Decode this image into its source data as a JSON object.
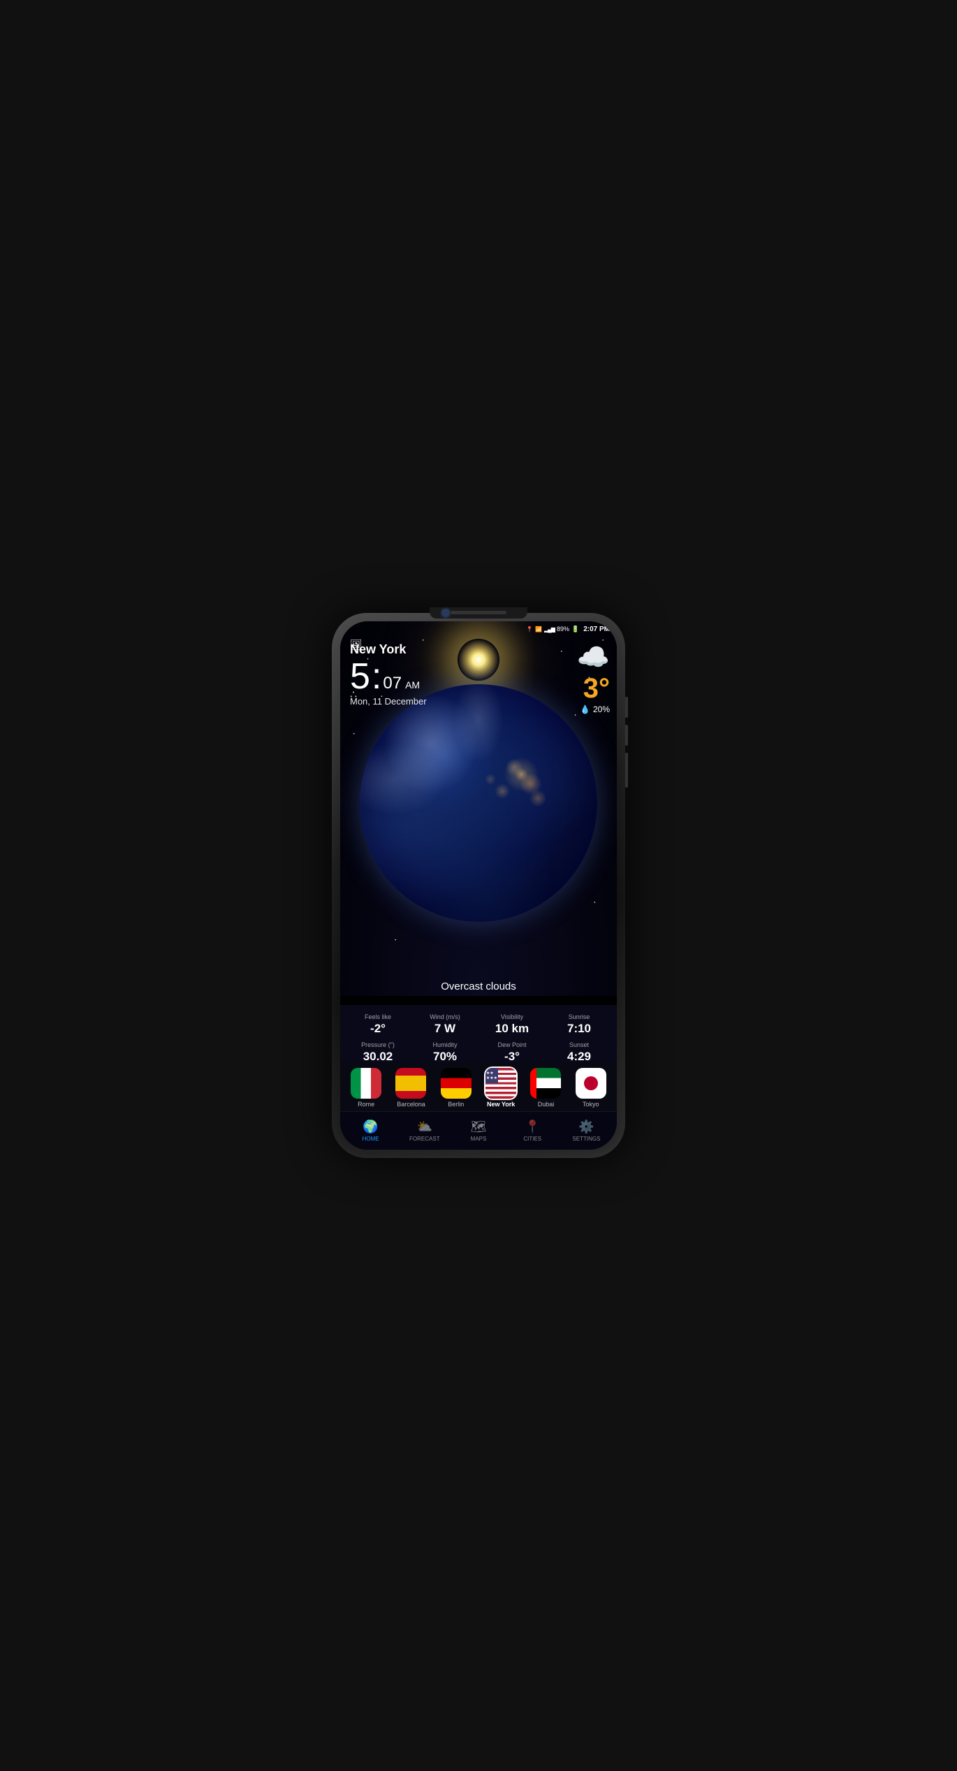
{
  "phone": {
    "status_bar": {
      "location_icon": "📍",
      "wifi_icon": "wifi",
      "signal_icon": "signal",
      "battery": "89%",
      "time": "2:07 PM"
    },
    "weather": {
      "city": "New York",
      "time_hour": "5",
      "time_min": "07",
      "time_ampm": "AM",
      "date": "Mon, 11 December",
      "temperature": "3°",
      "rain_percent": "20%",
      "condition": "Overcast clouds",
      "details": [
        {
          "label": "Feels like",
          "value": "-2°",
          "sub": ""
        },
        {
          "label": "Wind (m/s)",
          "value": "7 W",
          "sub": ""
        },
        {
          "label": "Visibility",
          "value": "10 km",
          "sub": ""
        },
        {
          "label": "Sunrise",
          "value": "7:10",
          "sub": ""
        },
        {
          "label": "Pressure (\")",
          "value": "30.02",
          "sub": ""
        },
        {
          "label": "Humidity",
          "value": "70%",
          "sub": ""
        },
        {
          "label": "Dew Point",
          "value": "-3°",
          "sub": ""
        },
        {
          "label": "Sunset",
          "value": "4:29",
          "sub": ""
        }
      ]
    },
    "cities": [
      {
        "id": "rome",
        "label": "Rome",
        "flag_type": "rome",
        "active": false
      },
      {
        "id": "barcelona",
        "label": "Barcelona",
        "flag_type": "barcelona",
        "active": false
      },
      {
        "id": "berlin",
        "label": "Berlin",
        "flag_type": "berlin",
        "active": false
      },
      {
        "id": "newyork",
        "label": "New York",
        "flag_type": "newyork",
        "active": true
      },
      {
        "id": "dubai",
        "label": "Dubai",
        "flag_type": "dubai",
        "active": false
      },
      {
        "id": "tokyo",
        "label": "Tokyo",
        "flag_type": "tokyo",
        "active": false
      }
    ],
    "nav": [
      {
        "id": "home",
        "label": "HOME",
        "icon": "🌍",
        "active": true
      },
      {
        "id": "forecast",
        "label": "FORECAST",
        "icon": "⛅",
        "active": false
      },
      {
        "id": "maps",
        "label": "MAPS",
        "icon": "🗺",
        "active": false
      },
      {
        "id": "cities",
        "label": "CITIES",
        "icon": "📍",
        "active": false
      },
      {
        "id": "settings",
        "label": "SETTINGS",
        "icon": "⚙",
        "active": false
      }
    ]
  }
}
